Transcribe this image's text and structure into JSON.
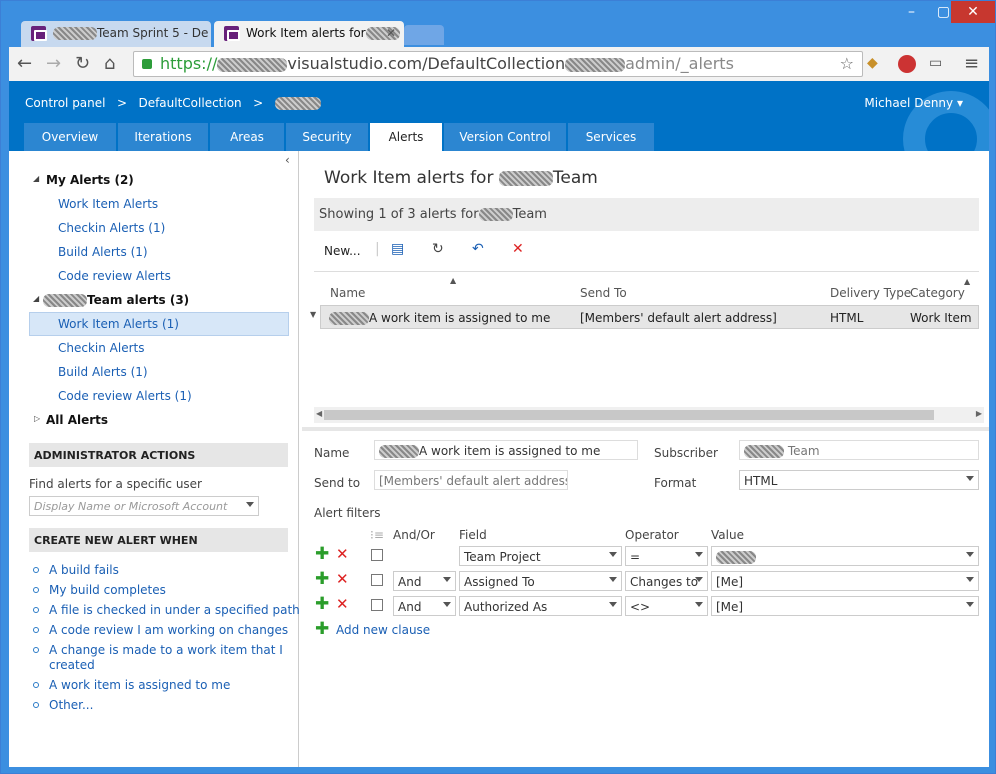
{
  "browser": {
    "tabs": [
      {
        "label": "Team Sprint 5 - De"
      },
      {
        "label": "Work Item alerts for"
      }
    ],
    "url_prefix": "https://",
    "url_main": "visualstudio.com/DefaultCollection",
    "url_suffix": "admin/_alerts",
    "win_min": "–",
    "win_max": "▢",
    "win_close": "✕"
  },
  "header": {
    "crumb_control_panel": "Control panel",
    "crumb_sep": ">",
    "crumb_collection": "DefaultCollection",
    "user": "Michael Denny"
  },
  "hub_tabs": [
    "Overview",
    "Iterations",
    "Areas",
    "Security",
    "Alerts",
    "Version Control",
    "Services"
  ],
  "sidebar": {
    "my_alerts": "My Alerts (2)",
    "my_items": [
      "Work Item Alerts",
      "Checkin Alerts (1)",
      "Build Alerts (1)",
      "Code review Alerts"
    ],
    "team_alerts": "Team alerts (3)",
    "team_items": [
      "Work Item Alerts (1)",
      "Checkin Alerts",
      "Build Alerts (1)",
      "Code review Alerts (1)"
    ],
    "all_alerts": "All Alerts",
    "admin_header": "ADMINISTRATOR ACTIONS",
    "find_label": "Find alerts for a specific user",
    "find_placeholder": "Display Name or Microsoft Account",
    "create_header": "CREATE NEW ALERT WHEN",
    "create_items": [
      "A build fails",
      "My build completes",
      "A file is checked in under a specified path",
      "A code review I am working on changes",
      "A change is made to a work item that I",
      "created",
      "A work item is assigned to me",
      "Other..."
    ]
  },
  "main": {
    "title_prefix": "Work Item alerts for",
    "title_suffix": "Team",
    "showing_prefix": "Showing 1 of 3 alerts for",
    "showing_suffix": "Team",
    "toolbar_new": "New...",
    "columns": [
      "Name",
      "Send To",
      "Delivery Type",
      "Category"
    ],
    "row": {
      "name": "A work item is assigned to me",
      "send_to": "[Members' default alert address]",
      "delivery": "HTML",
      "category": "Work Item"
    }
  },
  "detail": {
    "name_label": "Name",
    "name_value": "A work item is assigned to me",
    "subscriber_label": "Subscriber",
    "subscriber_value": "Team",
    "sendto_label": "Send to",
    "sendto_placeholder": "[Members' default alert address]",
    "format_label": "Format",
    "format_value": "HTML",
    "filters_label": "Alert filters",
    "col_andor": "And/Or",
    "col_field": "Field",
    "col_operator": "Operator",
    "col_value": "Value",
    "clauses": [
      {
        "andor": "",
        "field": "Team Project",
        "operator": "=",
        "value": ""
      },
      {
        "andor": "And",
        "field": "Assigned To",
        "operator": "Changes to",
        "value": "[Me]"
      },
      {
        "andor": "And",
        "field": "Authorized As",
        "operator": "<>",
        "value": "[Me]"
      }
    ],
    "add_clause": "Add new clause"
  },
  "colors": {
    "header_blue": "#0072c6",
    "tab_blue": "#2c86d1",
    "link": "#1a5fb4",
    "add_green": "#2a9d2a",
    "delete_red": "#d22222"
  }
}
